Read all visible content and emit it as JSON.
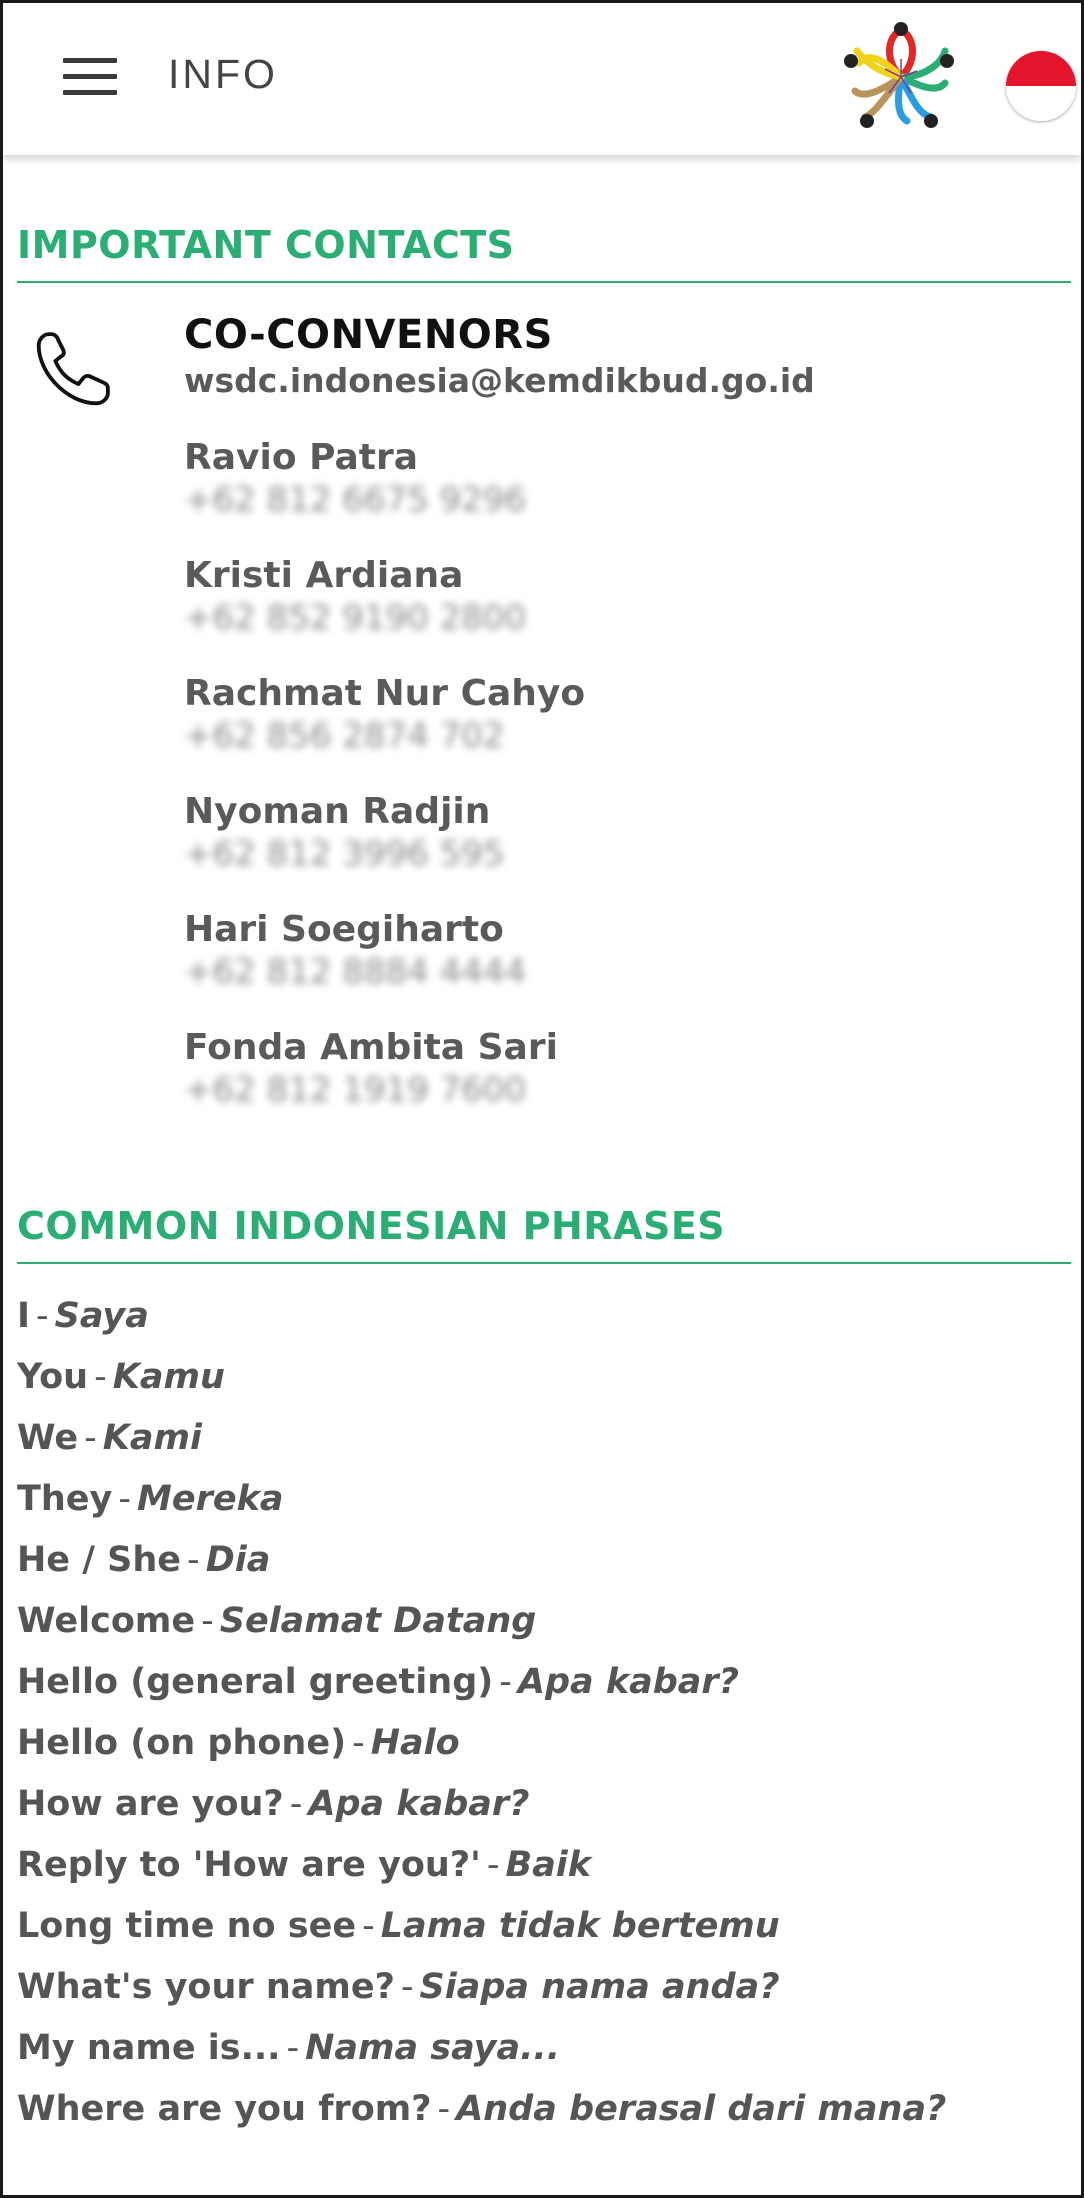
{
  "header": {
    "title": "INFO",
    "logo_icon": "flower-logo-icon",
    "flag_icon": "indonesia-flag-icon",
    "colors": {
      "accent": "#2aae73",
      "flag_red": "#e3142b",
      "flag_white": "#ffffff"
    }
  },
  "contacts_section": {
    "title": "IMPORTANT CONTACTS",
    "icon": "phone-icon",
    "lead": {
      "name": "CO-CONVENORS",
      "email": "wsdc.indonesia@kemdikbud.go.id"
    },
    "people": [
      {
        "name": "Ravio Patra",
        "phone": "+62 812 6675 9296"
      },
      {
        "name": "Kristi Ardiana",
        "phone": "+62 852 9190 2800"
      },
      {
        "name": "Rachmat Nur Cahyo",
        "phone": "+62 856 2874 702"
      },
      {
        "name": "Nyoman Radjin",
        "phone": "+62 812 3996 595"
      },
      {
        "name": "Hari Soegiharto",
        "phone": "+62 812 8884 4444"
      },
      {
        "name": "Fonda Ambita Sari",
        "phone": "+62 812 1919 7600"
      }
    ]
  },
  "phrases_section": {
    "title": "COMMON INDONESIAN PHRASES",
    "separator": "-",
    "items": [
      {
        "en": "I",
        "id": "Saya"
      },
      {
        "en": "You",
        "id": "Kamu"
      },
      {
        "en": "We",
        "id": "Kami"
      },
      {
        "en": "They",
        "id": "Mereka"
      },
      {
        "en": "He / She",
        "id": "Dia"
      },
      {
        "en": "Welcome",
        "id": "Selamat Datang"
      },
      {
        "en": "Hello (general greeting)",
        "id": "Apa kabar?"
      },
      {
        "en": "Hello (on phone)",
        "id": "Halo"
      },
      {
        "en": "How are you?",
        "id": "Apa kabar?"
      },
      {
        "en": "Reply to 'How are you?'",
        "id": "Baik"
      },
      {
        "en": "Long time no see",
        "id": "Lama tidak bertemu"
      },
      {
        "en": "What's your name?",
        "id": "Siapa nama anda?"
      },
      {
        "en": "My name is...",
        "id": "Nama saya..."
      },
      {
        "en": "Where are you from?",
        "id": "Anda berasal dari mana?"
      }
    ]
  }
}
